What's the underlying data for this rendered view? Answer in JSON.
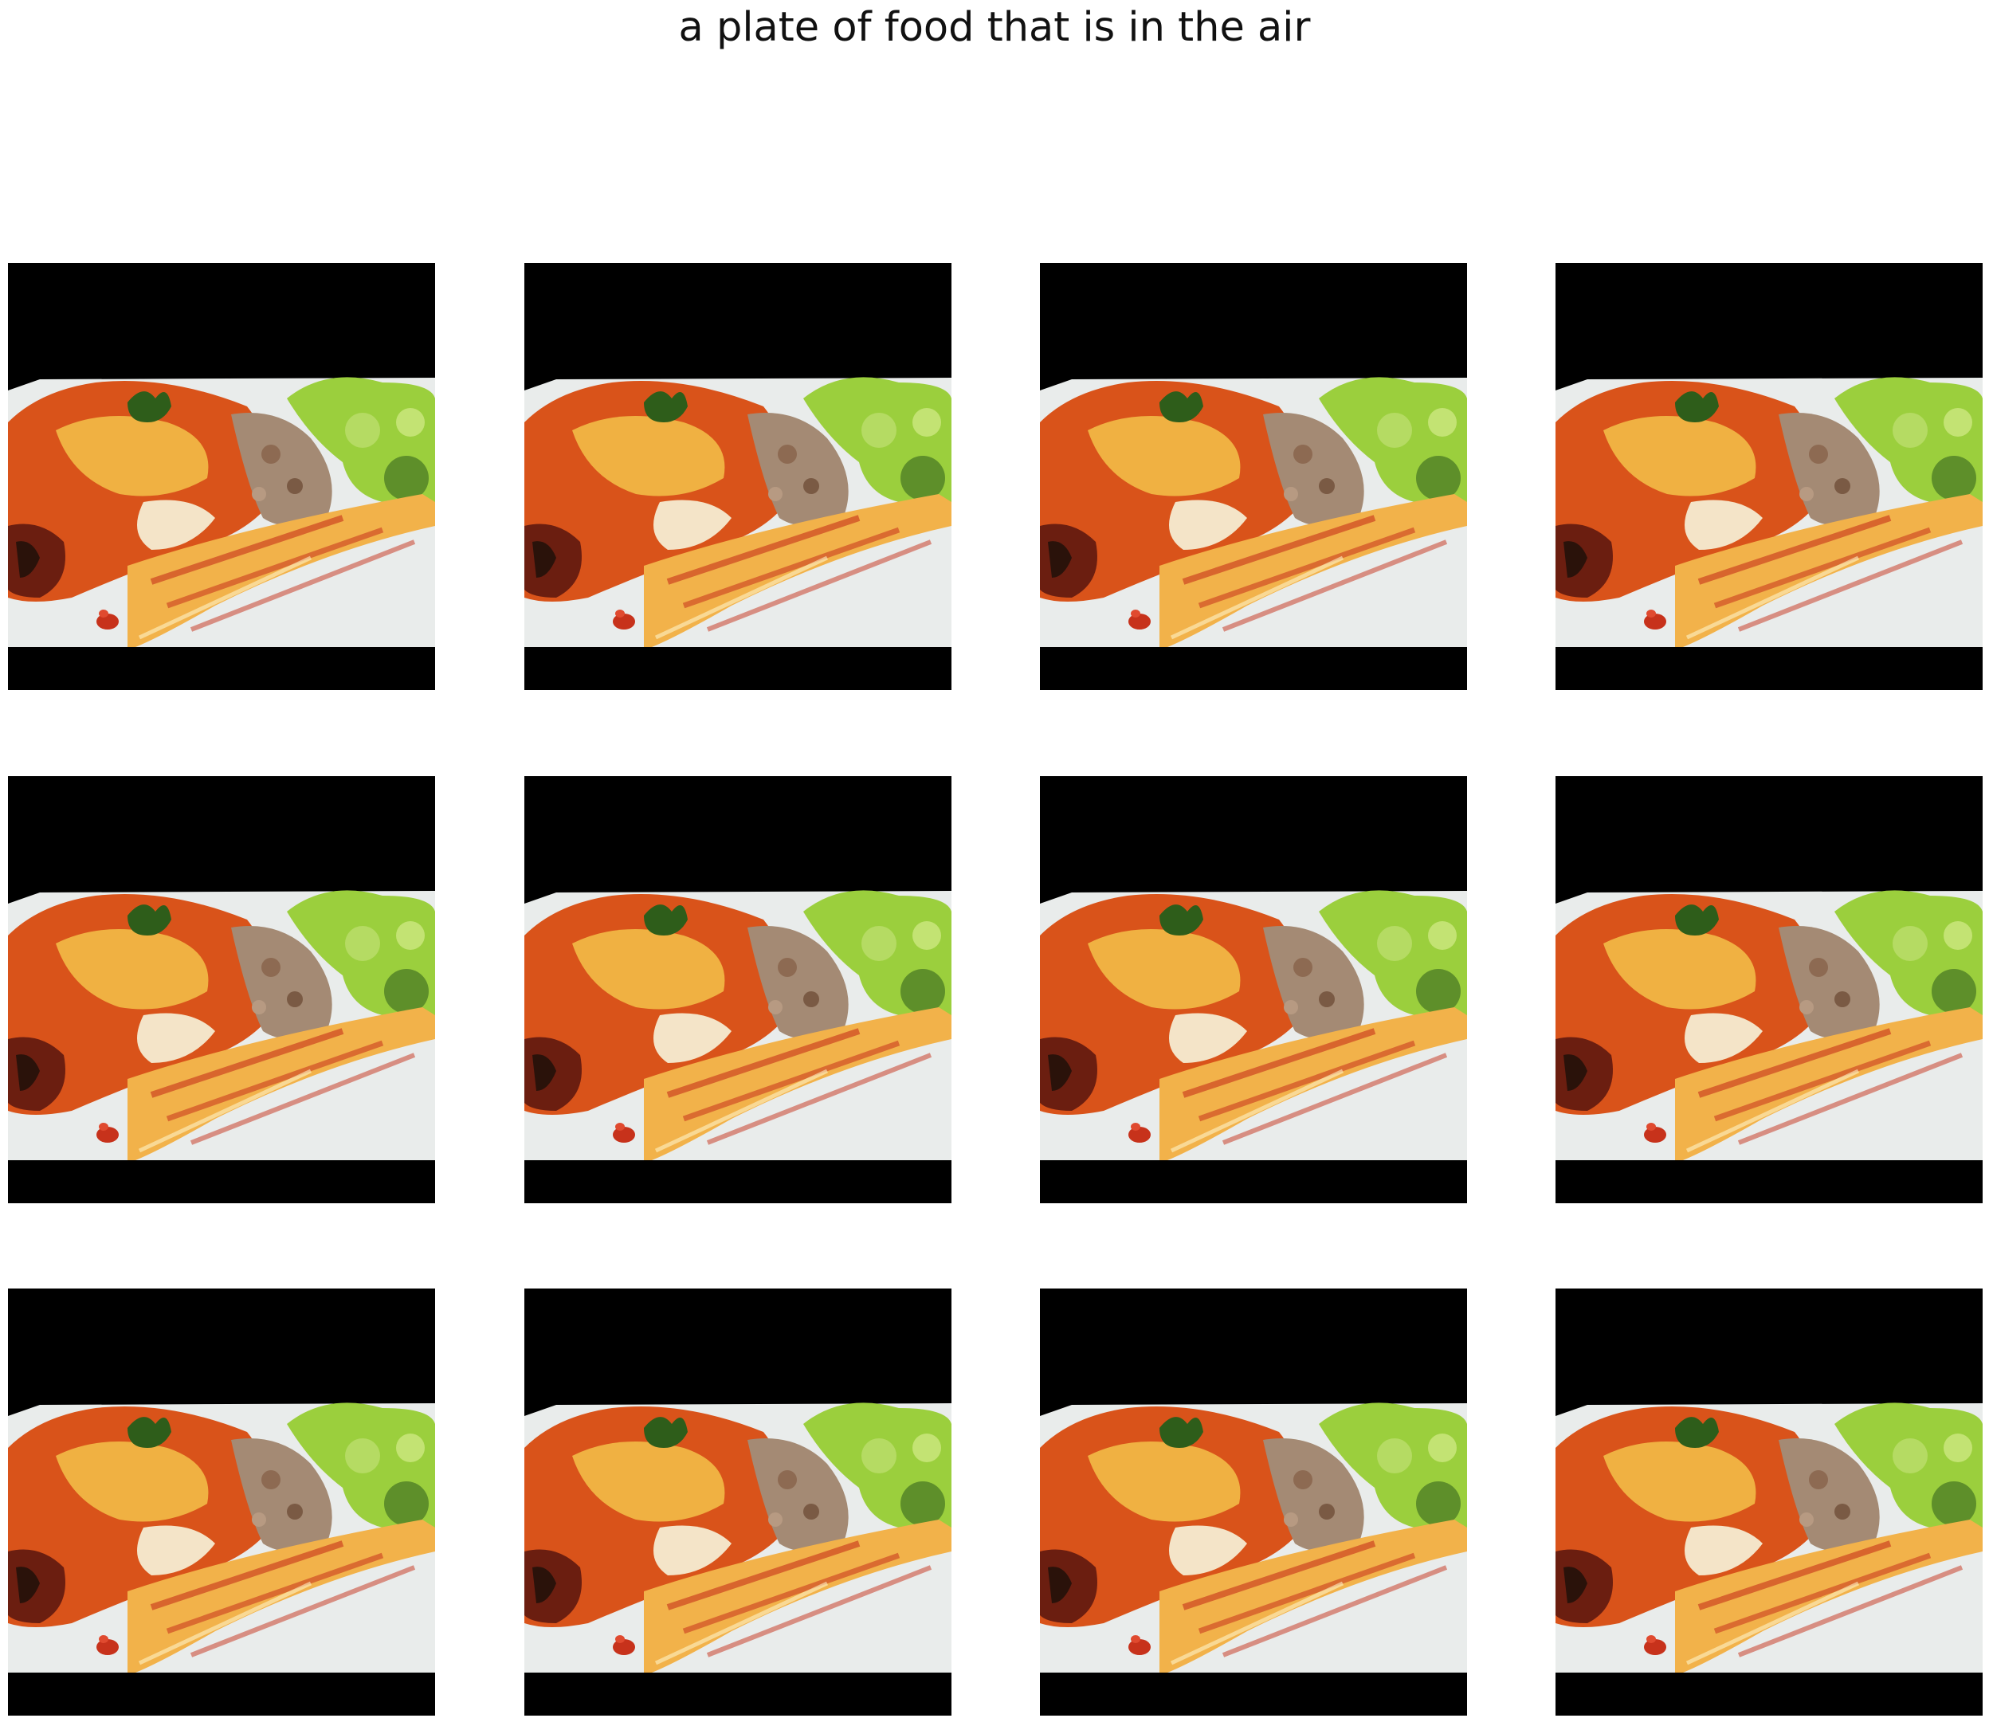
{
  "figure": {
    "title": "a plate of food that is in the air"
  },
  "grid": {
    "rows": 3,
    "columns": 4,
    "tiles": [
      {
        "content": "food-photo"
      },
      {
        "content": "food-photo"
      },
      {
        "content": "food-photo"
      },
      {
        "content": "food-photo"
      },
      {
        "content": "food-photo"
      },
      {
        "content": "food-photo"
      },
      {
        "content": "food-photo"
      },
      {
        "content": "food-photo"
      },
      {
        "content": "food-photo"
      },
      {
        "content": "food-photo"
      },
      {
        "content": "food-photo"
      },
      {
        "content": "food-photo"
      }
    ]
  },
  "colors": {
    "letterbox": "#000000",
    "plate": "#e9eceb",
    "lasagna": "#d9531a",
    "cheese": "#f3c24a",
    "pasta": "#f2b24a",
    "sauce": "#c7321b",
    "broccoli": "#9bcf3d",
    "parsley": "#2e5d1a",
    "meat": "#a48a74"
  }
}
